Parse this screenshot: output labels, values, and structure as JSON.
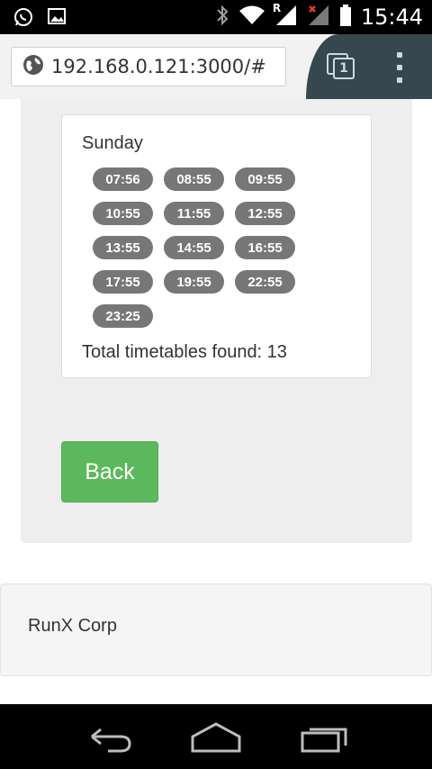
{
  "status_bar": {
    "time": "15:44",
    "left_icons": [
      "whatsapp-icon",
      "image-icon"
    ],
    "right_icons": [
      "bluetooth-icon",
      "wifi-icon",
      "signal-roaming-icon",
      "signal-no-service-icon",
      "battery-icon"
    ],
    "roaming_label": "R"
  },
  "browser": {
    "url": "192.168.0.121:3000/#",
    "tab_count": "1"
  },
  "schedule": {
    "day": "Sunday",
    "times": [
      "07:56",
      "08:55",
      "09:55",
      "10:55",
      "11:55",
      "12:55",
      "13:55",
      "14:55",
      "16:55",
      "17:55",
      "19:55",
      "22:55",
      "23:25"
    ],
    "total_text": "Total timetables found: 13"
  },
  "actions": {
    "back_label": "Back"
  },
  "footer": {
    "text": "RunX Corp"
  },
  "colors": {
    "back_button": "#5cb85c",
    "time_badge": "#777777",
    "toolbar_dark": "#37474f"
  }
}
